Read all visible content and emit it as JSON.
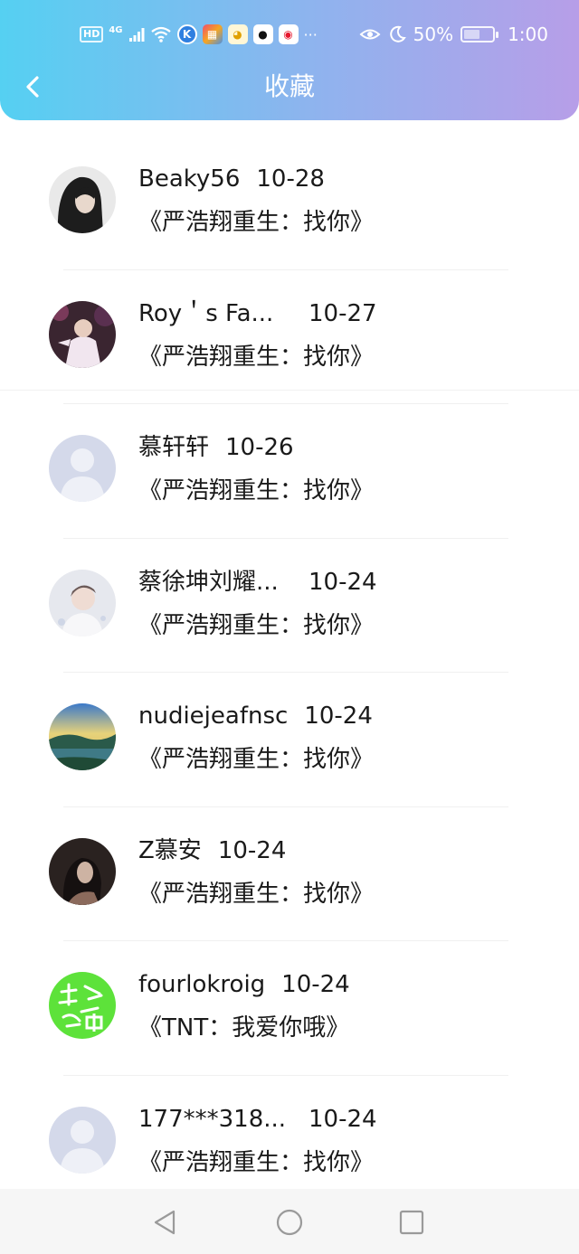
{
  "status_bar": {
    "network": "4G",
    "hd": "HD",
    "battery": "50%",
    "time": "1:00",
    "more": "···",
    "app_icons": [
      "k-icon",
      "puzzle-icon",
      "chick-icon",
      "qq-icon",
      "weibo-icon"
    ]
  },
  "header": {
    "title": "收藏",
    "back_icon": "chevron-left-icon"
  },
  "colors": {
    "header_gradient_start": "#55d0f2",
    "header_gradient_end": "#b79ee8",
    "nav_background": "#f6f6f6",
    "placeholder_avatar": "#d4d9ea"
  },
  "items": [
    {
      "name": "Beaky56",
      "date": "10-28",
      "title": "《严浩翔重生：找你》",
      "avatar": "dark-hair-photo"
    },
    {
      "name": "Roy＇s Fa...",
      "date": "10-27",
      "title": "《严浩翔重生：找你》",
      "avatar": "stage-performer-photo"
    },
    {
      "name": "慕轩轩",
      "date": "10-26",
      "title": "《严浩翔重生：找你》",
      "avatar": "default-avatar"
    },
    {
      "name": "蔡徐坤刘耀...",
      "date": "10-24",
      "title": "《严浩翔重生：找你》",
      "avatar": "light-portrait-photo"
    },
    {
      "name": "nudiejeafnsc",
      "date": "10-24",
      "title": "《严浩翔重生：找你》",
      "avatar": "landscape-photo"
    },
    {
      "name": "Z慕安",
      "date": "10-24",
      "title": "《严浩翔重生：找你》",
      "avatar": "dark-portrait-photo"
    },
    {
      "name": "fourlokroig",
      "date": "10-24",
      "title": "《TNT：我爱你哦》",
      "avatar": "green-text-avatar"
    },
    {
      "name": "177***318...",
      "date": "10-24",
      "title": "《严浩翔重生：找你》",
      "avatar": "default-avatar"
    }
  ],
  "nav": {
    "back": "triangle-back-icon",
    "home": "circle-home-icon",
    "recents": "square-recents-icon"
  }
}
